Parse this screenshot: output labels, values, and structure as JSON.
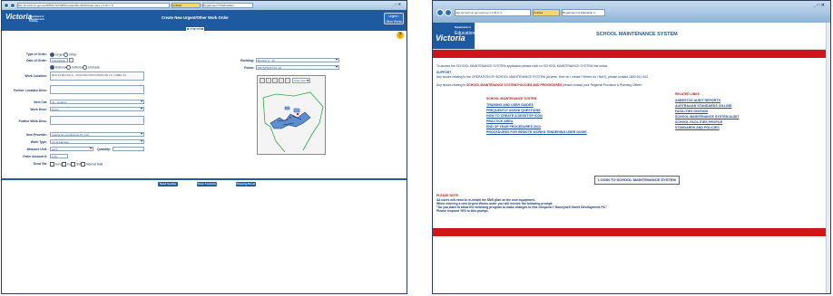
{
  "left": {
    "browser": {
      "address": "http://pmsi3.vic.gov.au/SMSSYSV/SMSCreateOtherWorkOrder.aspx  ρ ▾ ⊠ C ✕",
      "tabs": [
        "Untitled",
        "Department Of Education..."
      ],
      "win_controls": "_ □ ✕"
    },
    "header": {
      "logo": "Victoria",
      "logo_sub": "Department of Education and Training",
      "title": "Create New Urgent/Other Work Order",
      "action_button": "Urgent / Other Works"
    },
    "menu": {
      "tab": "Main Menu"
    },
    "help_icon": "?",
    "form": {
      "type_of_order_label": "Type of Order:",
      "type_urgent": "Urgent",
      "type_other": "Other",
      "date_label": "Date of Order:",
      "date_value": "11/11/2016",
      "priority_options": [
        "Rational",
        "Deferred",
        "Unmade"
      ],
      "location_label": "Work Location:",
      "location_value": "BLD 34 BLOCK A - 10  ROOM PROVISION 0/0 1A, LABEL 34",
      "further_location_label": "Further Location Desc:",
      "item_cat_label": "Item Cat:",
      "item_cat_value": "31 - Heating",
      "work_desc_label": "Work Desc:",
      "work_desc_value": "Ducts",
      "further_work_label": "Further Work Desc:",
      "item_provider_label": "Item Provider:",
      "item_provider_value": "Acacia Air-conditioning Pty Ltd",
      "work_type_label": "Work Type:",
      "work_type_value": "Fix & Damage",
      "measure_label": "Measure Unit:",
      "measure_value": "each",
      "quantity_label": "Quantity:",
      "quantity_value": "",
      "order_amount_label": "Order Amount $:",
      "order_amount_value": "0.00",
      "send_via_label": "Send Via:",
      "send_via_options": [
        "Email",
        "Fax",
        "SMS",
        "Normal Mail"
      ],
      "building_label": "Building:",
      "building_value": "BLOCK A - 10",
      "room_label": "Room:",
      "room_value": "PROVISION 0/1 1A",
      "map_zoom": "Scale View (fit)"
    },
    "buttons": [
      "Send Update",
      "Clear Contents",
      "Drawing Reset"
    ]
  },
  "right": {
    "browser": {
      "address": "http://pmsi3.vic.gov.au/sms/  ρ ▾ ⊠ C ✕",
      "tabs": [
        "Untitled",
        "Department of Education a..."
      ],
      "win_controls": "_ □ ✕"
    },
    "header": {
      "logo": "Victoria",
      "logo_sub1": "Department of",
      "logo_sub2": "Education",
      "title": "SCHOOL MAINTENANCE SYSTEM"
    },
    "intro": {
      "line1": "To access the SCHOOL MAINTENANCE SYSTEM application please click on SCHOOL MAINTENANCE SYSTEM link below.",
      "support_heading": "SUPPORT",
      "line2": "Any issues relating to the OPERATION OF SCHOOL MAINTENANCE SYSTEM (Access, How do I create? Where do I find?), please contact 1800 641 943.",
      "line3_pre": "Any issues relating to ",
      "line3_red": "SCHOOL MAINTENANCE SYSTEM POLICIES AND PROCEDURES",
      "line3_post": " please contact your Regional Provision & Planning Officer"
    },
    "left_links_heading": "SCHOOL MAINTENANCE SYSTEM",
    "left_links": [
      "TRAINING AND USER GUIDES",
      "FREQUENTLY ASKED QUESTIONS",
      "HOW TO CREATE A DESKTOP ICON",
      "PRACTICE AREA",
      "END OF YEAR PROCEDURES 2012",
      "PROCEDURES FOR REMOTE WORKS TENDERING USER GUIDE"
    ],
    "right_links_heading": "RELATED LINKS",
    "right_links": [
      "ASBESTOS AUDIT REPORTS",
      "AUSTRALIAN STANDARDS ON-LINE",
      "FACILITIES DIVISION",
      "SCHOOL MAINTENANCE SYSTEM AUDIT",
      "SCHOOL FACILITIES PROFILE",
      "STANDARDS AND POLICIES"
    ],
    "login_button": "LOGIN TO SCHOOL MAINTENANCE SYSTEM",
    "notes": {
      "heading": "PLEASE NOTE:",
      "n1": "All users will need to re-install the SMS plan on the new equipment.",
      "n2": "When entering a new Urgent Works order you will receive the following prompt:",
      "n3": "\"Do you want to allow the following program to make changes to this computer? Honeywell Street Development P/L\"",
      "n4": "Please respond YES to this prompt."
    }
  }
}
